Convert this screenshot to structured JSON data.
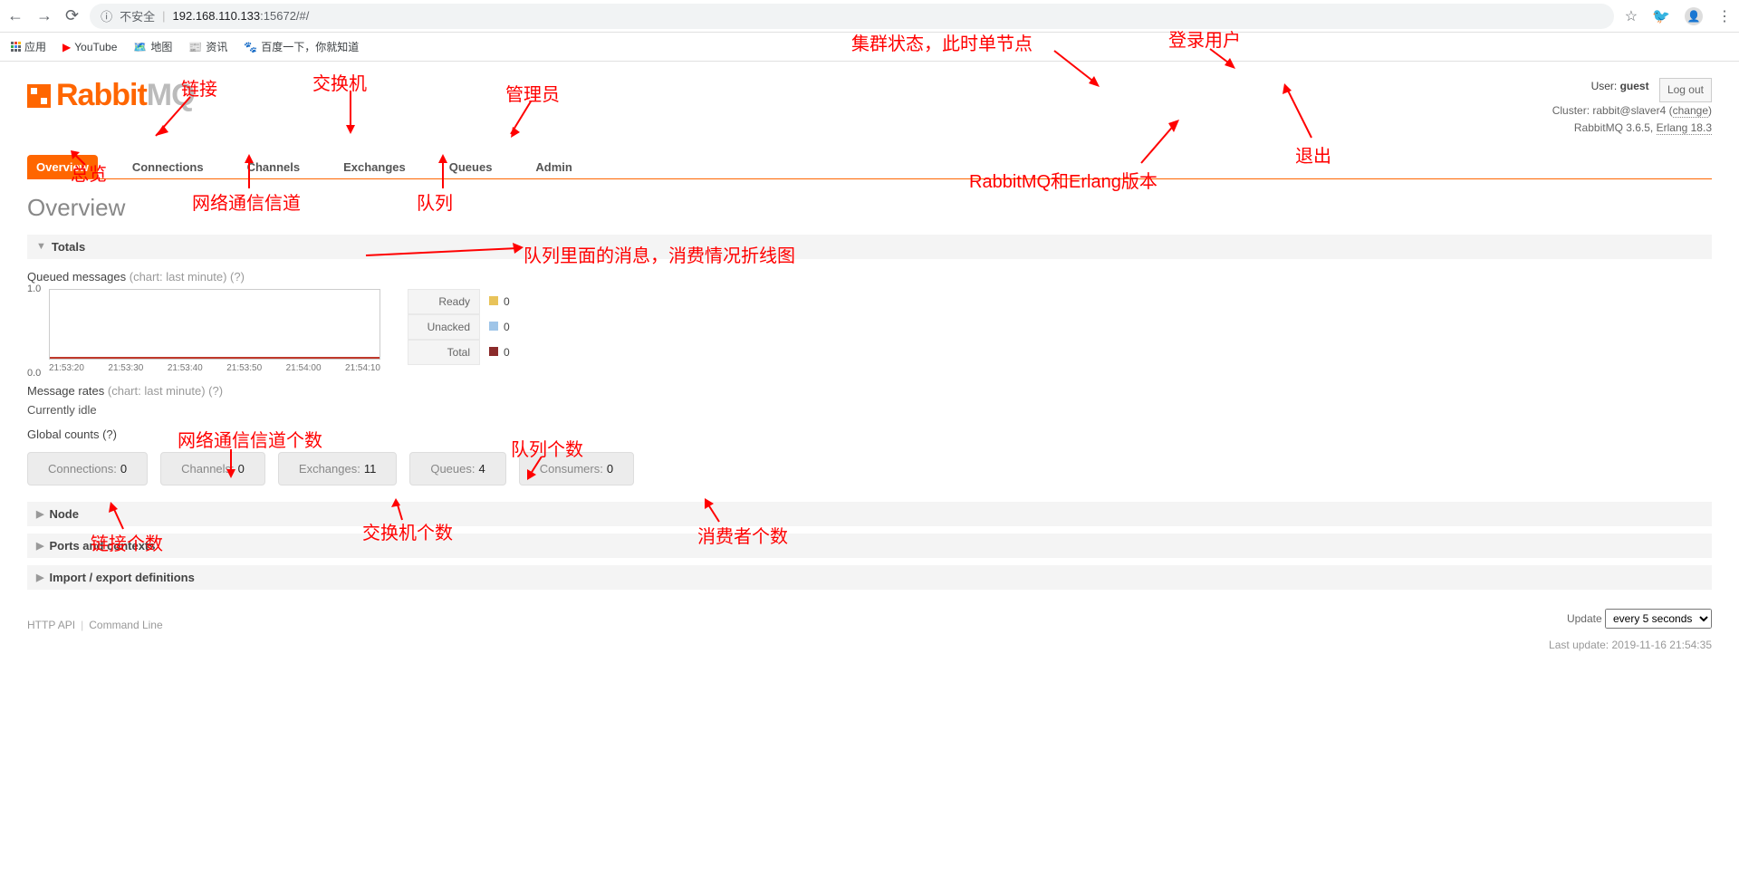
{
  "browser": {
    "insecure_label": "不安全",
    "url_host": "192.168.110.133",
    "url_rest": ":15672/#/",
    "bookmarks_apps": "应用",
    "bookmarks": [
      "YouTube",
      "地图",
      "资讯",
      "百度一下，你就知道"
    ]
  },
  "logo": {
    "text1": "Rabbit",
    "text2": "MQ"
  },
  "header": {
    "user_label": "User:",
    "user": "guest",
    "cluster_label": "Cluster:",
    "cluster": "rabbit@slaver4",
    "change": "change",
    "version_label": "RabbitMQ 3.6.5,",
    "erlang": "Erlang 18.3",
    "logout": "Log out"
  },
  "tabs": [
    "Overview",
    "Connections",
    "Channels",
    "Exchanges",
    "Queues",
    "Admin"
  ],
  "page_title": "Overview",
  "sections": {
    "totals": "Totals",
    "node": "Node",
    "ports": "Ports and contexts",
    "import": "Import / export definitions"
  },
  "queued_msgs_label": "Queued messages",
  "chart_hint": "(chart: last minute) (?)",
  "message_rates_label": "Message rates",
  "currently_idle": "Currently idle",
  "global_counts_label": "Global counts (?)",
  "legend": {
    "ready": "Ready",
    "unacked": "Unacked",
    "total": "Total",
    "val": "0"
  },
  "counts": {
    "connections_label": "Connections:",
    "connections": "0",
    "channels_label": "Channels:",
    "channels": "0",
    "exchanges_label": "Exchanges:",
    "exchanges": "11",
    "queues_label": "Queues:",
    "queues": "4",
    "consumers_label": "Consumers:",
    "consumers": "0"
  },
  "footer": {
    "api": "HTTP API",
    "cli": "Command Line"
  },
  "update": {
    "label": "Update",
    "selected": "every 5 seconds",
    "last_label": "Last update:",
    "last": "2019-11-16 21:54:35"
  },
  "annotations": {
    "overview": "总览",
    "connections": "链接",
    "channels": "网络通信信道",
    "exchanges": "交换机",
    "queues": "队列",
    "admin": "管理员",
    "cluster": "集群状态，此时单节点",
    "user": "登录用户",
    "logout": "退出",
    "version": "RabbitMQ和Erlang版本",
    "chart_desc": "队列里面的消息，消费情况折线图",
    "channels_count": "网络通信信道个数",
    "queues_count": "队列个数",
    "conn_count": "链接个数",
    "exch_count": "交换机个数",
    "consumers_count": "消费者个数"
  },
  "chart_data": {
    "type": "line",
    "title": "Queued messages (last minute)",
    "ylim": [
      0,
      1.0
    ],
    "x_ticks": [
      "21:53:20",
      "21:53:30",
      "21:53:40",
      "21:53:50",
      "21:54:00",
      "21:54:10"
    ],
    "series": [
      {
        "name": "Ready",
        "values": [
          0,
          0,
          0,
          0,
          0,
          0
        ],
        "color": "#e8c35a"
      },
      {
        "name": "Unacked",
        "values": [
          0,
          0,
          0,
          0,
          0,
          0
        ],
        "color": "#9fc5e8"
      },
      {
        "name": "Total",
        "values": [
          0,
          0,
          0,
          0,
          0,
          0
        ],
        "color": "#8b2b2b"
      }
    ]
  }
}
